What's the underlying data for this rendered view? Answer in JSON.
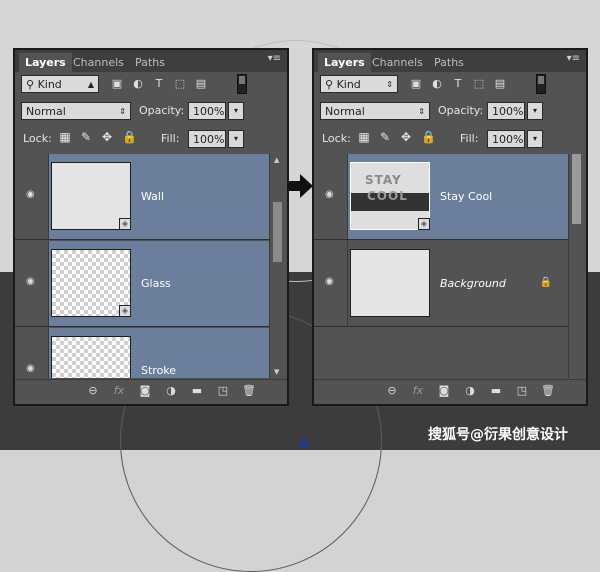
{
  "tabs": [
    "Layers",
    "Channels",
    "Paths"
  ],
  "kind_filter": "Kind",
  "blend_mode": "Normal",
  "opacity_label": "Opacity:",
  "opacity_value": "100%",
  "lock_label": "Lock:",
  "fill_label": "Fill:",
  "fill_value": "100%",
  "left_panel": {
    "layers": [
      {
        "name": "Wall",
        "selected": true,
        "thumb": "solid"
      },
      {
        "name": "Glass",
        "selected": true,
        "thumb": "checker"
      },
      {
        "name": "Stroke",
        "selected": true,
        "thumb": "checker"
      }
    ]
  },
  "right_panel": {
    "layers": [
      {
        "name": "Stay Cool",
        "selected": true,
        "thumb_text_1": "STAY",
        "thumb_text_2": "COOL"
      },
      {
        "name": "Background",
        "selected": false,
        "locked": true
      }
    ]
  },
  "watermark": "搜狐号@衍果创意设计",
  "icons": {
    "filter": [
      "image-filter-icon",
      "adjustment-filter-icon",
      "type-filter-icon",
      "shape-filter-icon",
      "smart-object-filter-icon"
    ],
    "lock": [
      "lock-transparent-icon",
      "lock-image-icon",
      "lock-position-icon",
      "lock-all-icon"
    ],
    "footer": [
      "link-layers-icon",
      "fx-icon",
      "mask-icon",
      "adjustment-icon",
      "group-icon",
      "new-layer-icon",
      "trash-icon"
    ]
  }
}
